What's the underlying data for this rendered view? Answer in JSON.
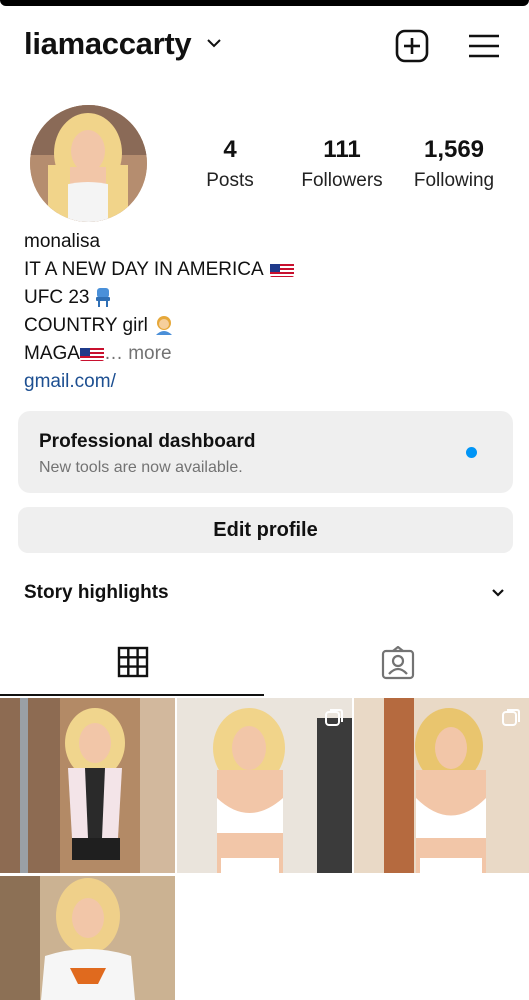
{
  "header": {
    "username": "liamaccarty"
  },
  "stats": [
    {
      "value": "4",
      "label": "Posts"
    },
    {
      "value": "111",
      "label": "Followers"
    },
    {
      "value": "1,569",
      "label": "Following"
    }
  ],
  "bio": {
    "name": "monalisa",
    "lines": [
      "IT A NEW DAY IN AMERICA",
      "UFC 23",
      "COUNTRY girl",
      "MAGA"
    ],
    "more": "… more",
    "link": "gmail.com/"
  },
  "dashboard": {
    "title": "Professional dashboard",
    "subtitle": "New tools are now available."
  },
  "edit_profile": "Edit profile",
  "story_highlights": "Story highlights",
  "colors": {
    "accent_blue": "#0095f6",
    "button_bg": "#efefef",
    "link_blue": "#1d4f91"
  },
  "icons": [
    "chevron-down-icon",
    "new-post-icon",
    "menu-icon",
    "grid-icon",
    "tagged-icon",
    "multi-post-icon"
  ]
}
